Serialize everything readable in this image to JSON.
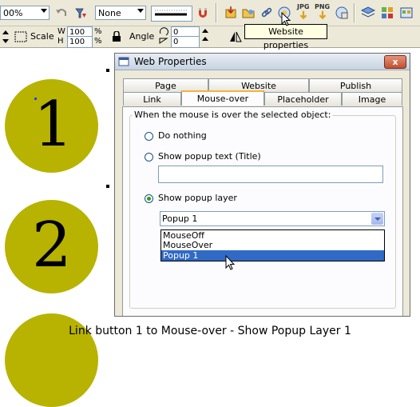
{
  "toolbar1": {
    "zoom_value": "00%",
    "fill_value": "None"
  },
  "toolbar2": {
    "scale_label": "Scale",
    "w_label": "W",
    "h_label": "H",
    "w_value": "100",
    "h_value": "100",
    "pct1": "%",
    "pct2": "%",
    "angle_label": "Angle",
    "angle_value": "0",
    "skew_value": "0",
    "jpg_label": "JPG",
    "png_label": "PNG"
  },
  "tooltip": "Website properties",
  "canvas": {
    "numerals": [
      "1",
      "2"
    ],
    "circle_color": "#b7b300"
  },
  "dialog": {
    "title": "Web Properties",
    "close_label": "x",
    "tabs_back": [
      "Page",
      "Website",
      "Publish"
    ],
    "tabs_front": [
      "Link",
      "Mouse-over",
      "Placeholder",
      "Image"
    ],
    "active_tab": "Mouse-over",
    "group_label": "When the mouse is over the selected object:",
    "options": [
      {
        "label": "Do nothing",
        "selected": false
      },
      {
        "label": "Show popup text (Title)",
        "selected": false
      },
      {
        "label": "Show popup layer",
        "selected": true
      }
    ],
    "popup_text_value": "",
    "popup_layer_value": "Popup 1",
    "dropdown_options": [
      "MouseOff",
      "MouseOver",
      "Popup 1"
    ],
    "dropdown_selected": "Popup 1"
  },
  "caption": "Link button 1 to Mouse-over - Show Popup Layer 1"
}
